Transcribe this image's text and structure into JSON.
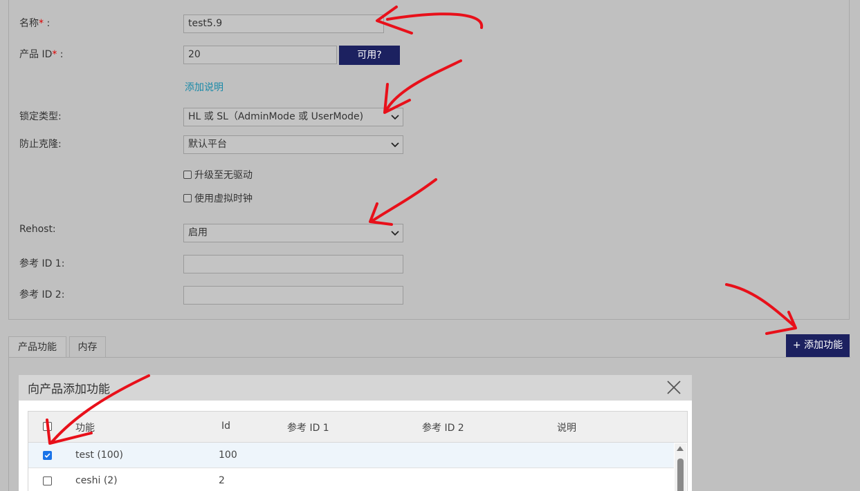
{
  "form": {
    "name_label": "名称",
    "name_req": "*",
    "name_colon": " :",
    "name_value": "test5.9",
    "product_id_label": "产品 ID",
    "product_id_req": "*",
    "product_id_colon": " :",
    "product_id_value": "20",
    "available_button": "可用?",
    "add_description_link": "添加说明",
    "lock_type_label": "锁定类型:",
    "lock_type_value": "HL 或 SL（AdminMode 或 UserMode)",
    "anti_clone_label": "防止克隆:",
    "anti_clone_value": "默认平台",
    "upgrade_driverless_label": "升级至无驱动",
    "use_virtual_clock_label": "使用虚拟时钟",
    "rehost_label": "Rehost:",
    "rehost_value": "启用",
    "ref_id1_label": "参考 ID 1:",
    "ref_id1_value": "",
    "ref_id2_label": "参考 ID 2:",
    "ref_id2_value": ""
  },
  "tabs": {
    "features": "产品功能",
    "memory": "内存"
  },
  "add_feature_button": "+ 添加功能",
  "dialog": {
    "title": "向产品添加功能",
    "columns": {
      "feature": "功能",
      "id": "Id",
      "ref1": "参考 ID 1",
      "ref2": "参考 ID 2",
      "desc": "说明"
    },
    "rows": [
      {
        "feature": "test (100)",
        "id": "100",
        "checked": true
      },
      {
        "feature": "ceshi (2)",
        "id": "2",
        "checked": false
      }
    ]
  },
  "colors": {
    "background": "#c0c0c0",
    "button_dark": "#1c2160",
    "link": "#1a8aa8",
    "required": "#dd0000",
    "annotation": "#e8101a",
    "checkbox_checked": "#1a73e8"
  },
  "icons": [
    "chevron-down-icon",
    "close-icon",
    "check-icon",
    "scroll-up-icon"
  ]
}
